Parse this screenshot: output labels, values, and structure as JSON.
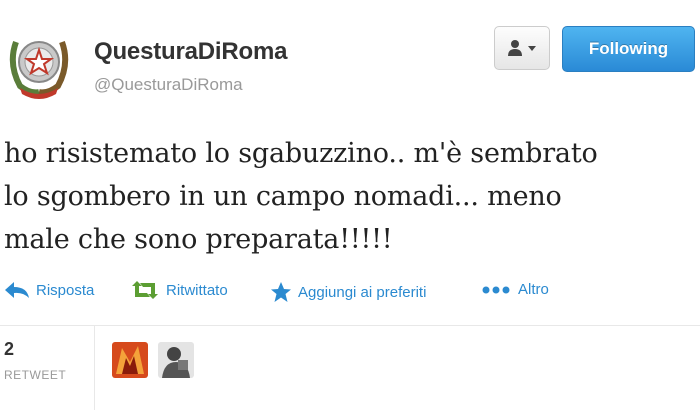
{
  "tweet": {
    "display_name": "QuesturaDiRoma",
    "handle": "@QuesturaDiRoma",
    "follow_label": "Following",
    "text_lines": [
      "ho risistemato lo sgabuzzino.. m'è sembrato",
      "lo sgombero in un campo nomadi... meno",
      "male che sono preparata!!!!!"
    ],
    "actions": {
      "reply": "Risposta",
      "retweet": "Ritwittato",
      "favorite": "Aggiungi ai preferiti",
      "more": "Altro"
    },
    "stats": {
      "retweet_count": "2",
      "retweet_label": "RETWEET"
    }
  },
  "icons": {
    "avatar": "italian-emblem-icon",
    "user_menu": "user-dropdown-icon",
    "reply": "reply-arrow-icon",
    "retweet": "retweet-icon",
    "favorite": "star-icon",
    "more": "dots-icon"
  },
  "colors": {
    "link": "#2b8ad0",
    "follow_button": "#2a8ad6",
    "retweet_active": "#5c9e33"
  }
}
